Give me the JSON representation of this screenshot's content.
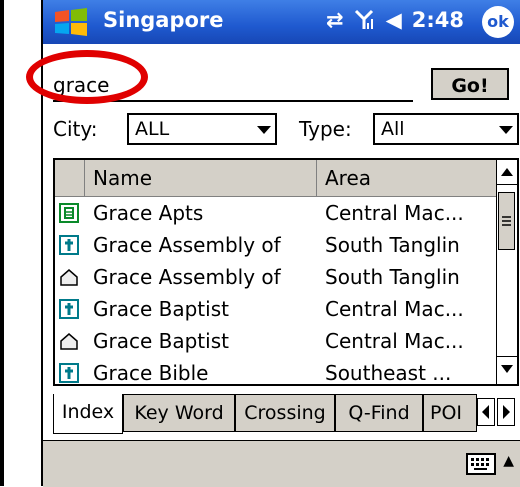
{
  "titlebar": {
    "title": "Singapore",
    "time": "2:48",
    "ok_label": "ok",
    "icons": [
      "windows-start-icon",
      "sync-arrows-icon",
      "signal-icon",
      "speaker-icon"
    ]
  },
  "search": {
    "value": "grace",
    "go_label": "Go!"
  },
  "filters": {
    "city_label": "City:",
    "city_value": "ALL",
    "type_label": "Type:",
    "type_value": "All"
  },
  "table": {
    "columns": [
      "Name",
      "Area"
    ],
    "rows": [
      {
        "icon": "building-icon",
        "name": "Grace Apts",
        "area": "Central Mac..."
      },
      {
        "icon": "church-cross-icon",
        "name": "Grace Assembly of",
        "area": "South Tanglin"
      },
      {
        "icon": "house-outline-icon",
        "name": "Grace Assembly of",
        "area": "South Tanglin"
      },
      {
        "icon": "church-cross-icon",
        "name": "Grace Baptist",
        "area": "Central Mac..."
      },
      {
        "icon": "house-outline-icon",
        "name": "Grace Baptist",
        "area": "Central Mac..."
      },
      {
        "icon": "church-cross-icon",
        "name": "Grace Bible",
        "area": "Southeast ..."
      }
    ]
  },
  "tabs": [
    "Index",
    "Key Word",
    "Crossing",
    "Q-Find",
    "POI"
  ],
  "colors": {
    "titlebar": "#1f59cf",
    "annotation_ring": "#e00000",
    "chrome": "#d4d0c8",
    "icon_green": "#0a8a2a",
    "icon_teal": "#007a8a"
  }
}
